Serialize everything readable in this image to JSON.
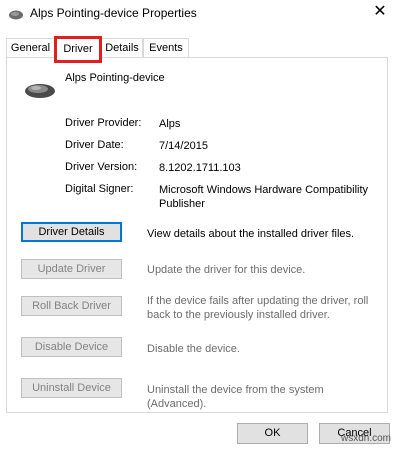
{
  "window": {
    "title": "Alps Pointing-device Properties",
    "close_label": "✕"
  },
  "tabs": [
    {
      "label": "General"
    },
    {
      "label": "Driver"
    },
    {
      "label": "Details"
    },
    {
      "label": "Events"
    }
  ],
  "device": {
    "name": "Alps Pointing-device",
    "icon": "mouse-icon"
  },
  "info": {
    "provider_label": "Driver Provider:",
    "provider_value": "Alps",
    "date_label": "Driver Date:",
    "date_value": "7/14/2015",
    "version_label": "Driver Version:",
    "version_value": "8.1202.1711.103",
    "signer_label": "Digital Signer:",
    "signer_value_line1": "Microsoft Windows Hardware Compatibility",
    "signer_value_line2": "Publisher"
  },
  "actions": [
    {
      "label": "Driver Details",
      "desc": "View details about the installed driver files."
    },
    {
      "label": "Update Driver",
      "desc": "Update the driver for this device."
    },
    {
      "label": "Roll Back Driver",
      "desc_line1": "If the device fails after updating the driver, roll",
      "desc_line2": "back to the previously installed driver."
    },
    {
      "label": "Disable Device",
      "desc": "Disable the device."
    },
    {
      "label": "Uninstall Device",
      "desc": "Uninstall the device from the system (Advanced)."
    }
  ],
  "footer": {
    "ok_label": "OK",
    "cancel_label": "Cancel"
  },
  "watermark": "wsxdn.com",
  "colors": {
    "active_tab_highlight": "#e02020",
    "primary_button_border": "#0078d7"
  }
}
